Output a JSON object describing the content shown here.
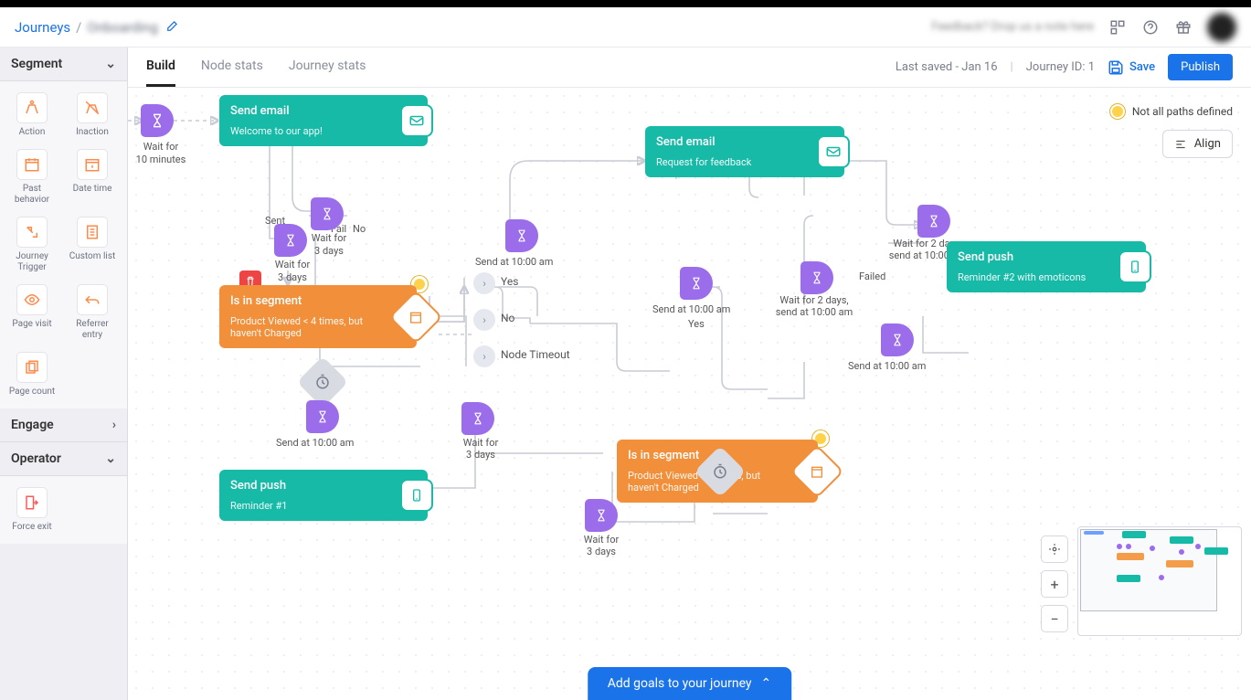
{
  "header": {
    "breadcrumb_root": "Journeys",
    "breadcrumb_sep": "/",
    "breadcrumb_name": "Onboarding",
    "feedback_text": "Feedback? Drop us a note here"
  },
  "toolbar": {
    "tabs": {
      "build": "Build",
      "node_stats": "Node stats",
      "journey_stats": "Journey stats"
    },
    "last_saved": "Last saved - Jan 16",
    "journey_id": "Journey ID: 1",
    "save": "Save",
    "publish": "Publish"
  },
  "sidebar": {
    "sections": {
      "segment": "Segment",
      "engage": "Engage",
      "operator": "Operator"
    },
    "segment_items": [
      {
        "label": "Action"
      },
      {
        "label": "Inaction"
      },
      {
        "label": "Past behavior"
      },
      {
        "label": "Date time"
      },
      {
        "label": "Journey Trigger"
      },
      {
        "label": "Custom list"
      },
      {
        "label": "Page visit"
      },
      {
        "label": "Referrer entry"
      },
      {
        "label": "Page count"
      }
    ],
    "operator_items": [
      {
        "label": "Force exit"
      }
    ]
  },
  "canvas": {
    "warning": "Not all paths defined",
    "align": "Align",
    "goals": "Add goals to your journey",
    "nodes": {
      "wait10": {
        "label": "Wait for\n10 minutes"
      },
      "email1": {
        "title": "Send email",
        "sub": "Welcome to our app!"
      },
      "wait3a": {
        "label": "Wait for\n3 days"
      },
      "wait3b": {
        "label": "Wait for\n3 days"
      },
      "send10a": "Send at 10:00 am",
      "send10b": "Send at 10:00 am",
      "send10c": "Send at 10:00 am",
      "send10d": "Send at 10:00 am",
      "seg1": {
        "title": "Is in segment",
        "sub": "Product Viewed < 4 times, but haven't Charged"
      },
      "push1": {
        "title": "Send push",
        "sub": "Reminder #1"
      },
      "email2": {
        "title": "Send email",
        "sub": "Request for feedback"
      },
      "seg2": {
        "title": "Is in segment",
        "sub": "Product Viewed < 4 times, but haven't Charged"
      },
      "wait3c": {
        "label": "Wait for\n3 days"
      },
      "wait3d": {
        "label": "Wait for\n3 days"
      },
      "wait2a": {
        "label": "Wait for 2 days, send at 10:00 am"
      },
      "wait2b": {
        "label": "Wait for 2 days, send at 10:00 am"
      },
      "push2": {
        "title": "Send push",
        "sub": "Reminder #2 with emoticons"
      },
      "branches": {
        "yes": "Yes",
        "no": "No",
        "timeout": "Node Timeout"
      },
      "sent": "Sent",
      "failed": "Failed",
      "fail": "Fail"
    }
  }
}
